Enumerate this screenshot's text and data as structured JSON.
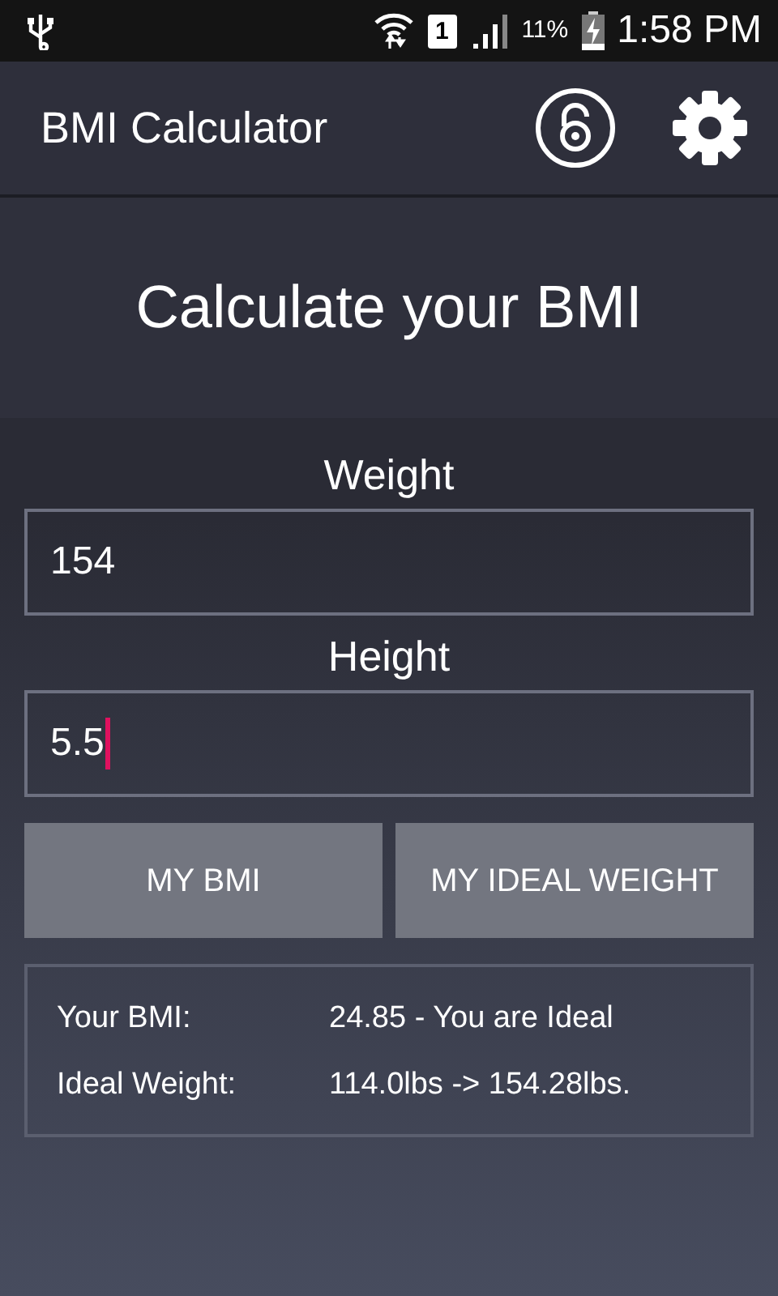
{
  "status_bar": {
    "sim": "1",
    "battery": "11%",
    "time": "1:58 PM"
  },
  "app_bar": {
    "title": "BMI Calculator"
  },
  "header": {
    "title": "Calculate your BMI"
  },
  "fields": [
    {
      "label": "Weight",
      "value": "154",
      "focused": false
    },
    {
      "label": "Height",
      "value": "5.5",
      "focused": true
    }
  ],
  "buttons": [
    "MY BMI",
    "MY IDEAL WEIGHT"
  ],
  "results": [
    {
      "label": "Your BMI:",
      "value": "24.85 - You are Ideal"
    },
    {
      "label": "Ideal Weight:",
      "value": "114.0lbs -> 154.28lbs."
    }
  ]
}
